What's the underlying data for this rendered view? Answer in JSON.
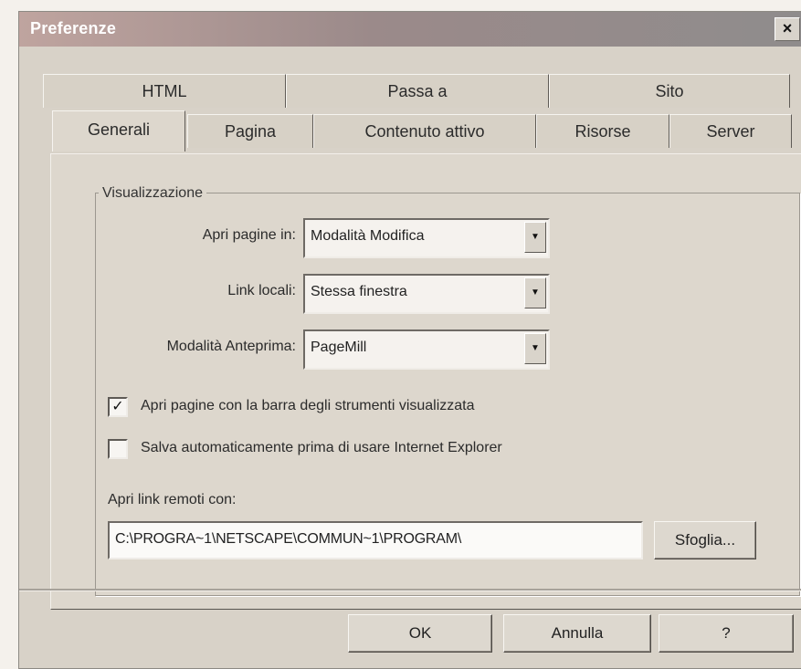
{
  "window": {
    "title": "Preferenze",
    "close_label": "×"
  },
  "tabs": {
    "row_back": [
      "HTML",
      "Passa a",
      "Sito"
    ],
    "row_front": [
      "Generali",
      "Pagina",
      "Contenuto attivo",
      "Risorse",
      "Server"
    ],
    "active": "Generali"
  },
  "group": {
    "label": "Visualizzazione"
  },
  "fields": {
    "apri_pagine": {
      "label": "Apri pagine in:",
      "value": "Modalità Modifica"
    },
    "link_locali": {
      "label": "Link locali:",
      "value": "Stessa finestra"
    },
    "anteprima": {
      "label": "Modalità Anteprima:",
      "value": "PageMill"
    }
  },
  "checkboxes": [
    {
      "label": "Apri pagine con la barra degli strumenti visualizzata",
      "checked": true
    },
    {
      "label": "Salva automaticamente prima di usare Internet Explorer",
      "checked": false
    }
  ],
  "remote": {
    "label": "Apri link remoti con:",
    "path": "C:\\PROGRA~1\\NETSCAPE\\COMMUN~1\\PROGRAM\\",
    "browse_label": "Sfoglia..."
  },
  "buttons": {
    "ok": "OK",
    "cancel": "Annulla",
    "help": "?"
  },
  "glyphs": {
    "dropdown": "▼",
    "check": "✓"
  }
}
